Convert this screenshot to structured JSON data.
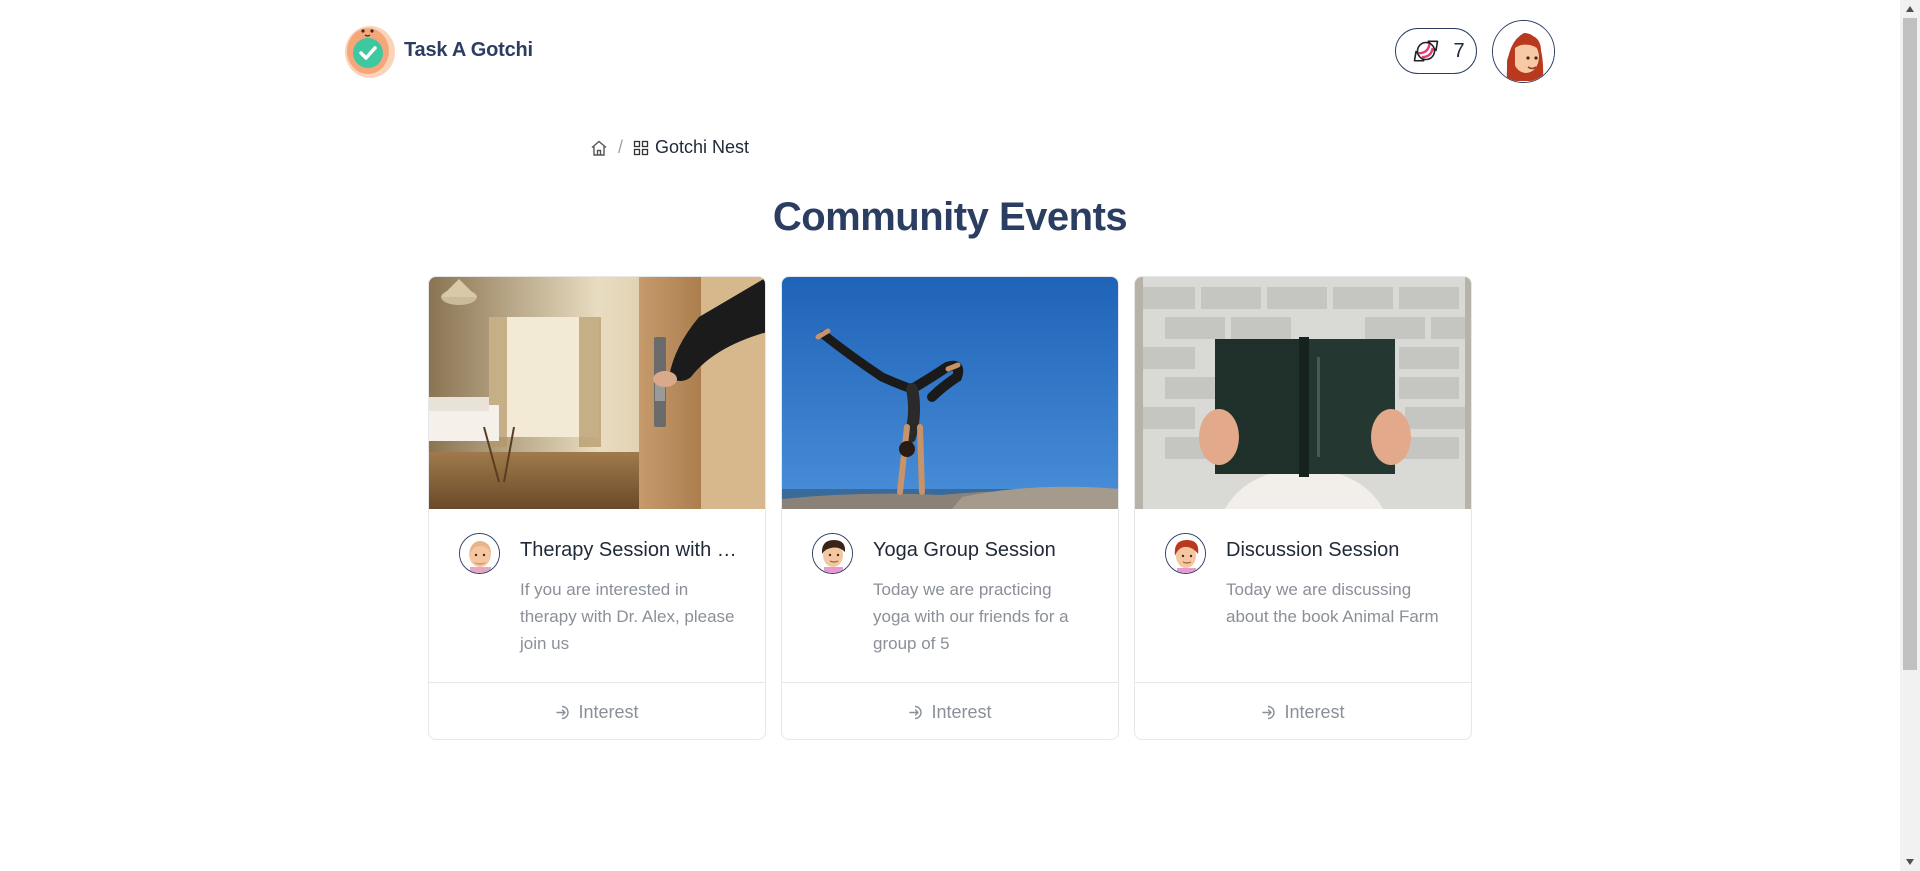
{
  "app": {
    "name": "Task A Gotchi"
  },
  "header": {
    "candy_count": "7",
    "candy_icon": "candy-icon",
    "avatar_icon": "user-avatar"
  },
  "breadcrumb": {
    "home_icon": "home-icon",
    "separator": "/",
    "current_icon": "grid-icon",
    "current_label": "Gotchi Nest"
  },
  "page": {
    "title": "Community Events"
  },
  "events": [
    {
      "title": "Therapy Session with Dr. Alex",
      "description": "If you are interested in therapy with Dr. Alex, please join us",
      "action_label": "Interest",
      "image": "hotel-room-photo"
    },
    {
      "title": "Yoga Group Session",
      "description": "Today we are practicing yoga with our friends for a group of 5",
      "action_label": "Interest",
      "image": "yoga-handstand-photo"
    },
    {
      "title": "Discussion Session",
      "description": "Today we are discussing about the book Animal Farm",
      "action_label": "Interest",
      "image": "reading-book-photo"
    }
  ],
  "colors": {
    "brand_navy": "#2b3e62",
    "muted_text": "#8a8f98",
    "border": "#e5e7eb"
  }
}
